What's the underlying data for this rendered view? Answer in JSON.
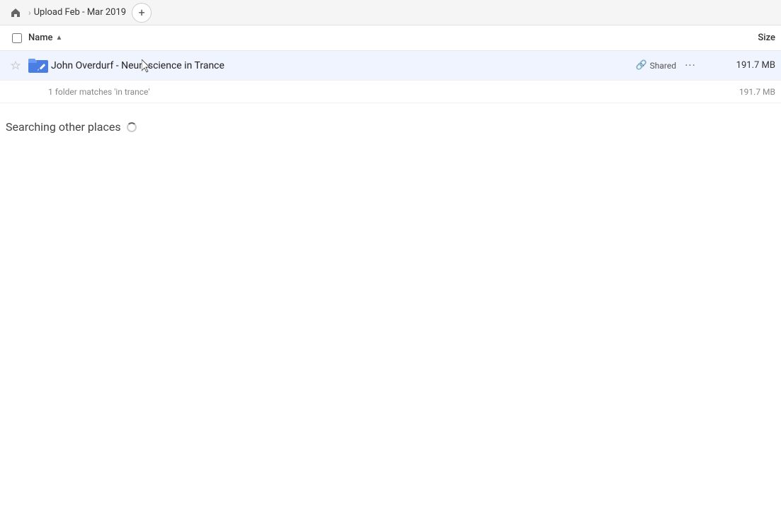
{
  "header": {
    "breadcrumb_title": "Upload Feb - Mar 2019",
    "add_button_label": "+"
  },
  "column_headers": {
    "checkbox_label": "",
    "name_label": "Name",
    "sort_indicator": "▲",
    "size_label": "Size"
  },
  "file_row": {
    "name": "John Overdurf - Neuroscience in Trance",
    "shared_label": "Shared",
    "more_label": "···",
    "size": "191.7 MB"
  },
  "sub_info": {
    "text": "1 folder matches 'in trance'",
    "size": "191.7 MB"
  },
  "searching": {
    "label": "Searching other places"
  }
}
